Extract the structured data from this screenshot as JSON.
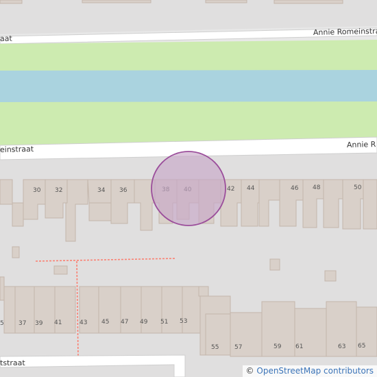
{
  "map": {
    "streets": {
      "top_full": "Annie Romeinstraat",
      "top_left_fragment": "aat",
      "mid_left_fragment": "einstraat",
      "mid_right_fragment": "Annie R",
      "bottom_left_fragment": "tstraat"
    },
    "house_numbers_north": [
      "30",
      "32",
      "34",
      "36",
      "38",
      "40",
      "42",
      "44",
      "46",
      "48",
      "50"
    ],
    "house_numbers_south_row": [
      "5",
      "37",
      "39",
      "41",
      "43",
      "45",
      "47",
      "49",
      "51",
      "53"
    ],
    "house_numbers_south_lower": [
      "55",
      "57",
      "59",
      "61",
      "63",
      "65"
    ],
    "marker": {
      "type": "circle-highlight",
      "color": "#9b4e9b"
    },
    "colors": {
      "land": "#e0dfdf",
      "grass": "#cdebb0",
      "water": "#aad3df",
      "road": "#ffffff",
      "building": "#d9d0c9",
      "building_outline": "#c4b6ab",
      "footway": "#fa8072"
    }
  },
  "attribution": {
    "symbol": "©",
    "text": "OpenStreetMap contributors"
  }
}
